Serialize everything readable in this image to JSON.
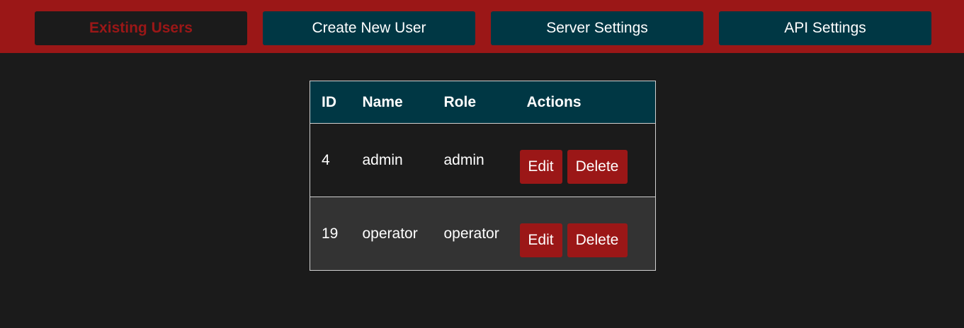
{
  "nav": {
    "tabs": [
      {
        "label": "Existing Users",
        "active": true
      },
      {
        "label": "Create New User",
        "active": false
      },
      {
        "label": "Server Settings",
        "active": false
      },
      {
        "label": "API Settings",
        "active": false
      }
    ]
  },
  "users_table": {
    "headers": {
      "id": "ID",
      "name": "Name",
      "role": "Role",
      "actions": "Actions"
    },
    "rows": [
      {
        "id": "4",
        "name": "admin",
        "role": "admin",
        "edit_label": "Edit",
        "delete_label": "Delete"
      },
      {
        "id": "19",
        "name": "operator",
        "role": "operator",
        "edit_label": "Edit",
        "delete_label": "Delete"
      }
    ]
  },
  "colors": {
    "accent_red": "#9b1717",
    "header_teal": "#003744",
    "background": "#1b1b1b",
    "row_alt": "#333333"
  }
}
